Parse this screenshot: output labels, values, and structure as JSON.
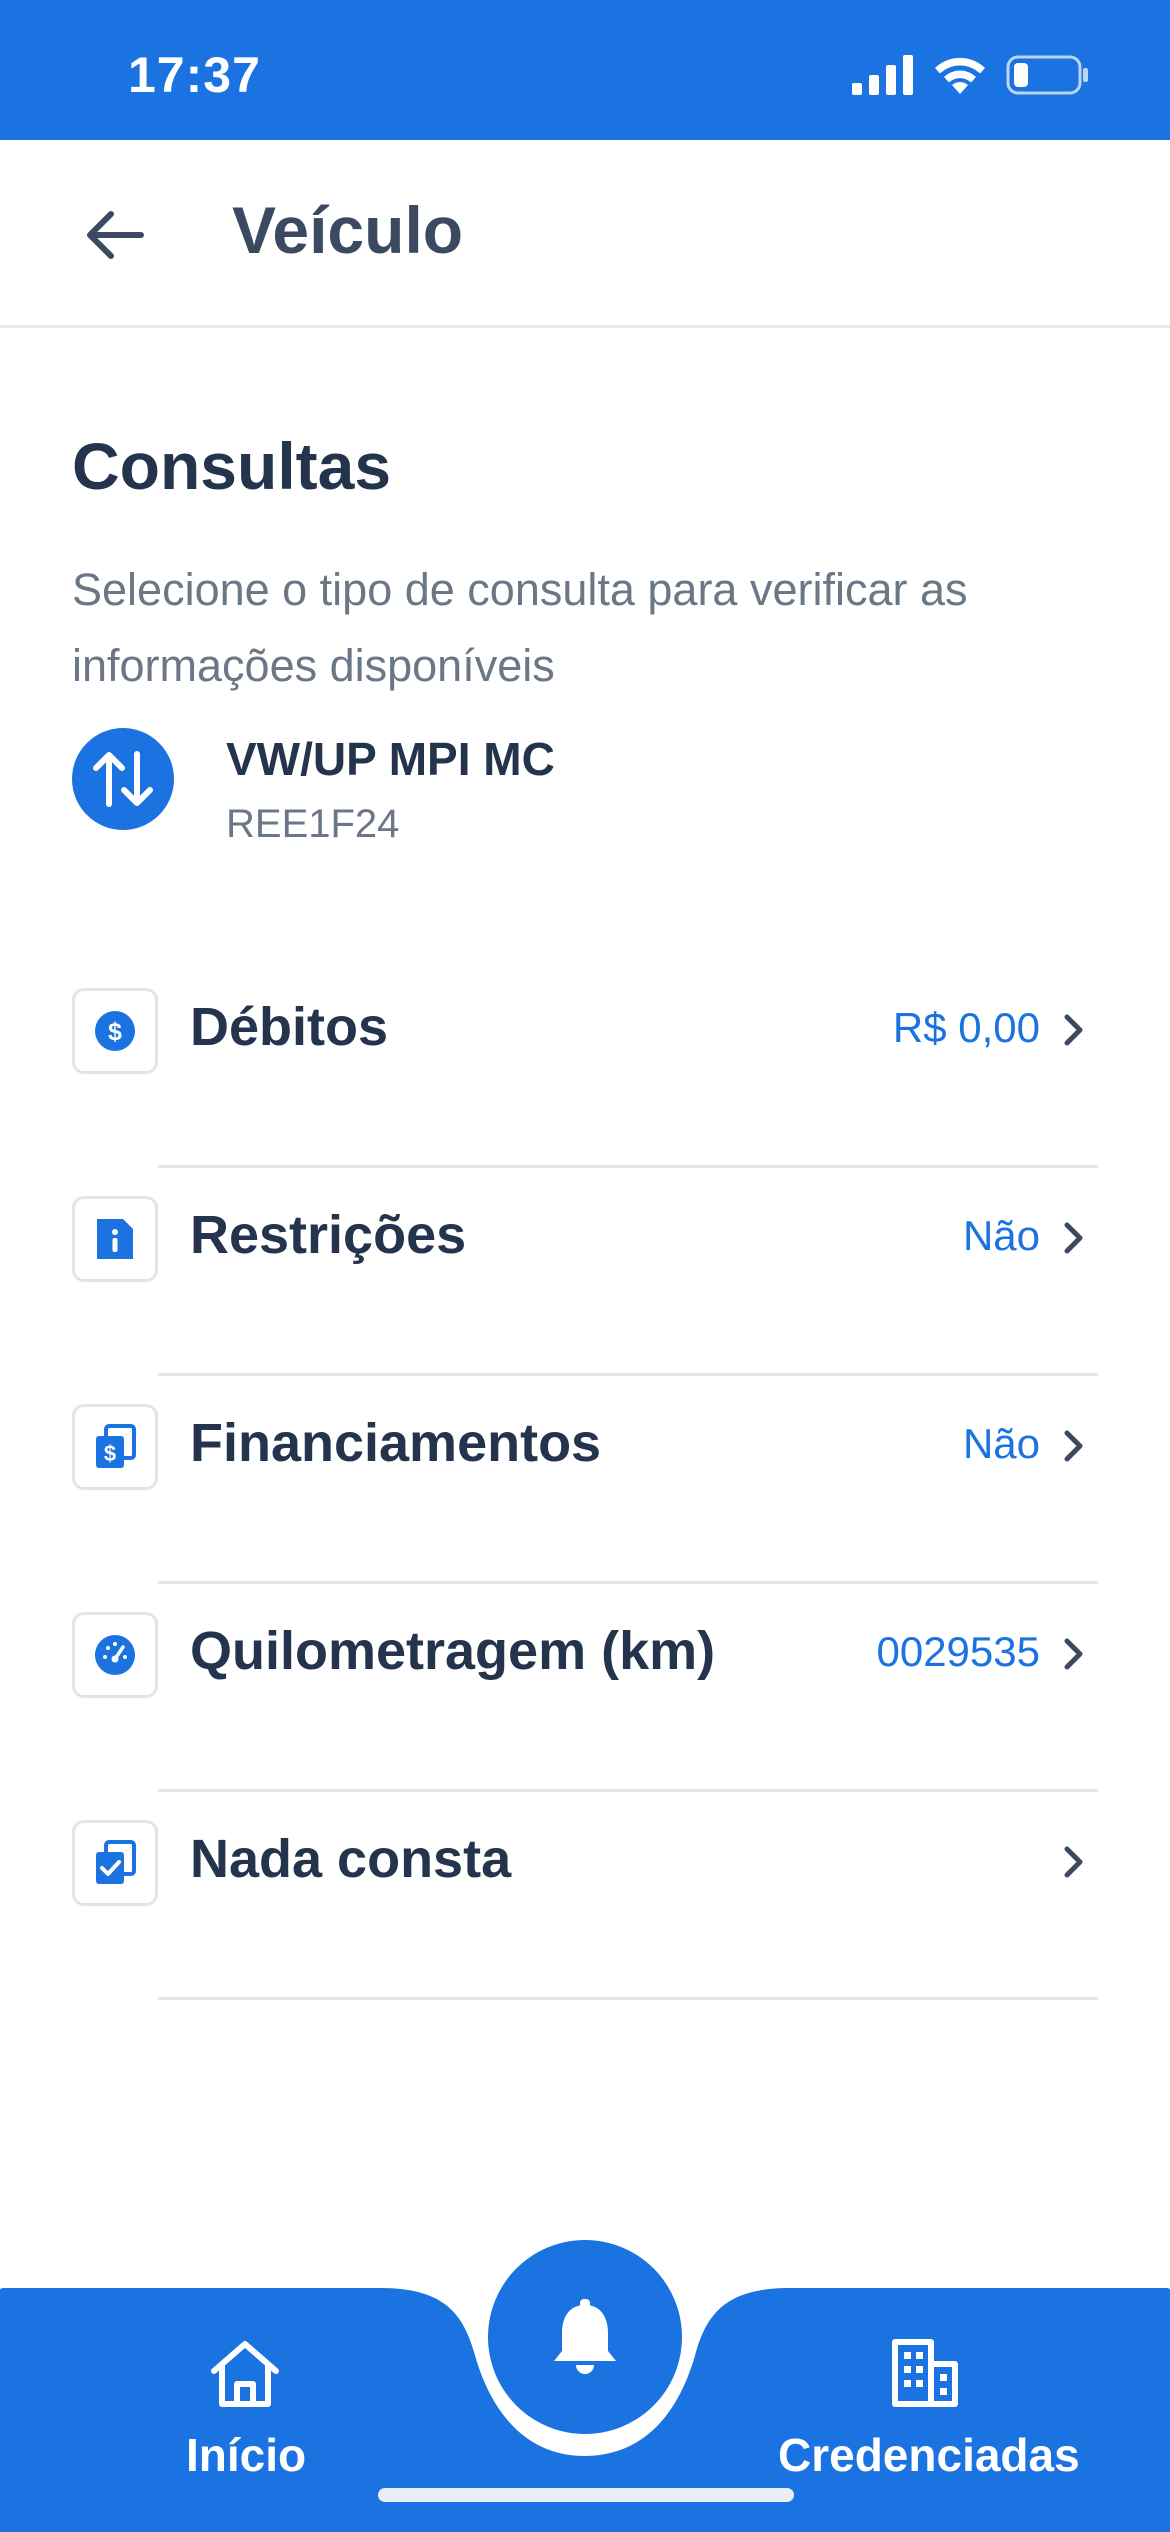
{
  "status_bar": {
    "time": "17:37"
  },
  "app_bar": {
    "title": "Veículo"
  },
  "section": {
    "title": "Consultas",
    "description": "Selecione o tipo de consulta para verificar as informações disponíveis"
  },
  "vehicle": {
    "name": "VW/UP MPI MC",
    "plate": "REE1F24"
  },
  "menu": {
    "items": [
      {
        "label": "Débitos",
        "value": "R$ 0,00",
        "icon": "dollar-icon"
      },
      {
        "label": "Restrições",
        "value": "Não",
        "icon": "info-icon"
      },
      {
        "label": "Financiamentos",
        "value": "Não",
        "icon": "document-money-icon"
      },
      {
        "label": "Quilometragem (km)",
        "value": "0029535",
        "icon": "speedometer-icon"
      },
      {
        "label": "Nada consta",
        "value": "",
        "icon": "document-check-icon"
      }
    ]
  },
  "bottom_nav": {
    "home_label": "Início",
    "credentialed_label": "Credenciadas"
  },
  "colors": {
    "primary": "#1a73e0",
    "text_dark": "#24344d",
    "text_muted": "#6b7787",
    "divider": "#e3e6eb"
  }
}
